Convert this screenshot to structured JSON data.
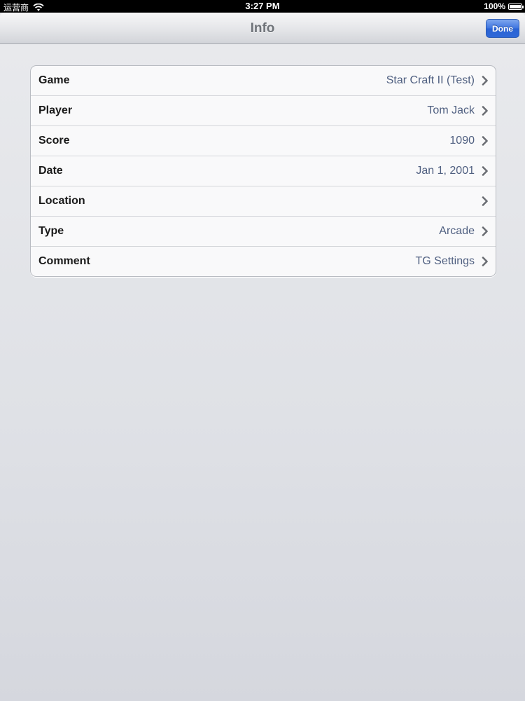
{
  "status_bar": {
    "carrier": "运营商",
    "time": "3:27 PM",
    "battery": "100%",
    "battery_level": 1.0
  },
  "nav_bar": {
    "title": "Info",
    "done_label": "Done"
  },
  "rows": [
    {
      "label": "Game",
      "value": "Star Craft II (Test)"
    },
    {
      "label": "Player",
      "value": "Tom Jack"
    },
    {
      "label": "Score",
      "value": "1090"
    },
    {
      "label": "Date",
      "value": "Jan 1, 2001"
    },
    {
      "label": "Location",
      "value": ""
    },
    {
      "label": "Type",
      "value": "Arcade"
    },
    {
      "label": "Comment",
      "value": "TG Settings"
    }
  ],
  "colors": {
    "accent_blue": "#2f68d8",
    "value_text": "#4f5f80"
  },
  "icons": [
    "wifi-icon",
    "battery-icon",
    "chevron-right-icon"
  ]
}
